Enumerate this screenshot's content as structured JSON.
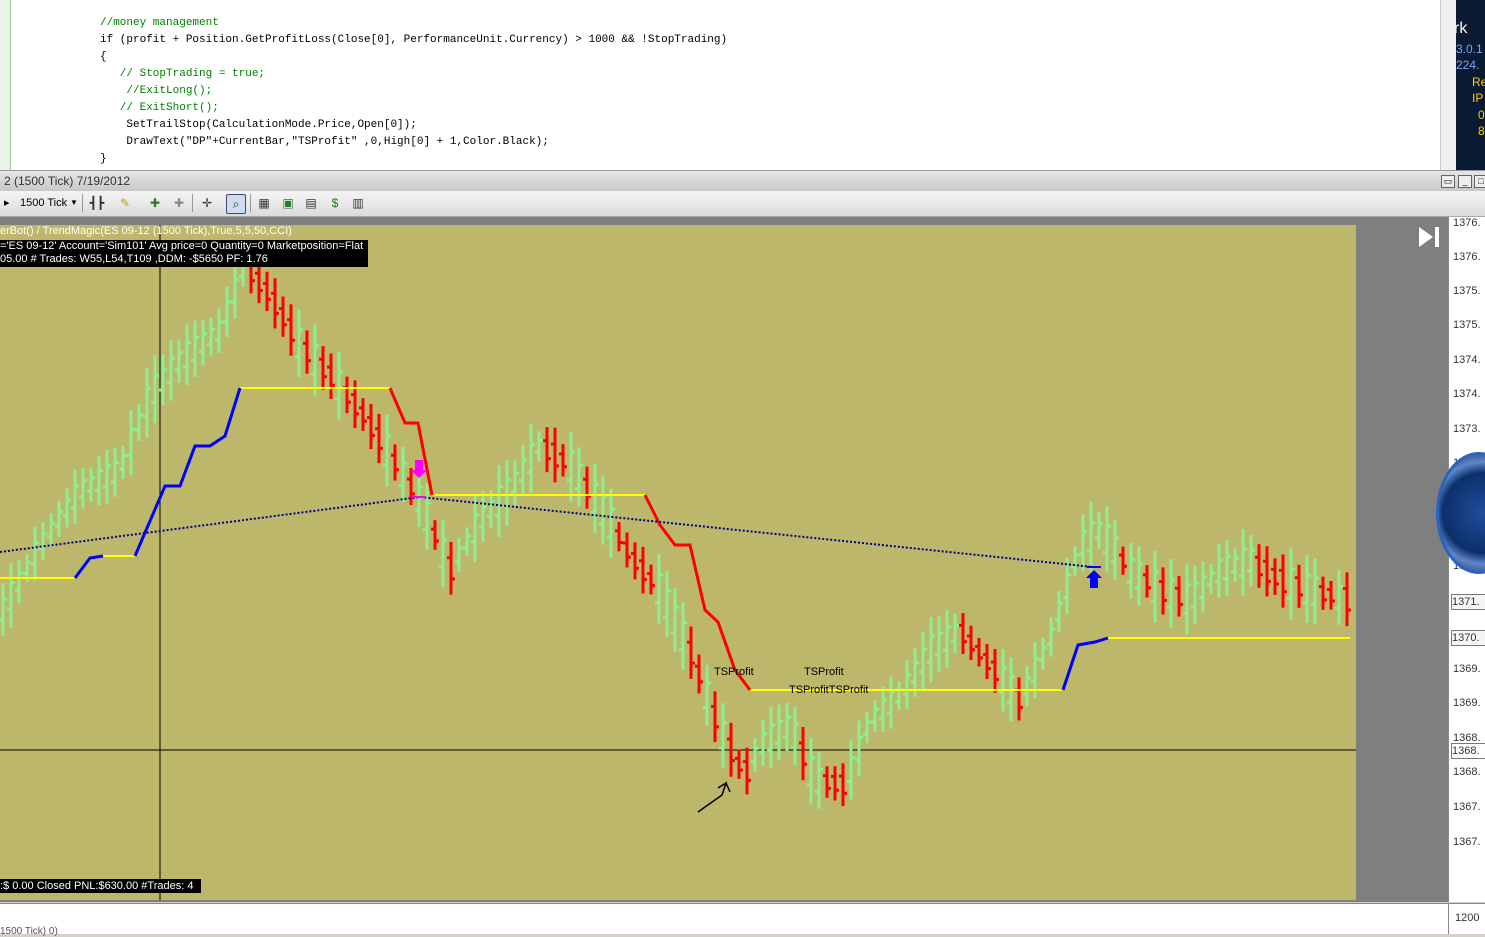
{
  "code_editor": {
    "lines": [
      {
        "cls": "cm",
        "text": "//money management"
      },
      {
        "cls": "",
        "text": "if (profit + Position.GetProfitLoss(Close[0], PerformanceUnit.Currency) > 1000 && !StopTrading)"
      },
      {
        "cls": "",
        "text": "{"
      },
      {
        "cls": "cm",
        "text": "   // StopTrading = true;"
      },
      {
        "cls": "cm",
        "text": "    //ExitLong();"
      },
      {
        "cls": "cm",
        "text": "   // ExitShort();"
      },
      {
        "cls": "",
        "text": "    SetTrailStop(CalculationMode.Price,Open[0]);"
      },
      {
        "cls": "",
        "text": "    DrawText(\"DP\"+CurrentBar,\"TSProfit\" ,0,High[0] + 1,Color.Black);"
      },
      {
        "cls": "",
        "text": "}"
      }
    ]
  },
  "side_panel": {
    "items": [
      {
        "text": "rk",
        "color": "#ffffff"
      },
      {
        "text": "3.0.1",
        "color": "#6fa8ff"
      },
      {
        "text": "224.",
        "color": "#6fa8ff"
      },
      {
        "text": "Re",
        "color": "#ffcc00"
      },
      {
        "text": "IP",
        "color": "#ffcc00"
      },
      {
        "text": "0",
        "color": "#ffcc00"
      },
      {
        "text": "8",
        "color": "#ffcc00"
      }
    ]
  },
  "window": {
    "title": "2 (1500 Tick)  7/19/2012"
  },
  "toolbar": {
    "interval": "1500 Tick"
  },
  "chart": {
    "indicator_label": "erBot() / TrendMagic(ES 09-12 (1500 Tick),True,5,5,50,CCI)",
    "info_line1": "='ES 09-12' Account='Sim101' Avg price=0 Quantity=0 Marketposition=Flat",
    "info_line2": "05.00 # Trades: W55,L54,T109 ,DDM: -$5650 PF: 1.76",
    "pnl_line": ":$ 0.00  Closed PNL:$630.00  #Trades: 4",
    "text_annotations": [
      "TSProfit",
      "TSProfit",
      "TSProfitTSProfit"
    ],
    "price_ticks": [
      "1376.",
      "1376.",
      "1375.",
      "1375.",
      "1374.",
      "1374.",
      "1373.",
      "1373.",
      "1372.",
      "1371.",
      "1371.",
      "1370.",
      "1370.",
      "1369.",
      "1369.",
      "1368.",
      "1368.",
      "1368.",
      "1367.",
      "1367."
    ],
    "price_flags": [
      "1371.",
      "1370.",
      "1368."
    ],
    "sub_label": "1500 Tick) 0)",
    "sub_tick": "1200",
    "colors": {
      "background": "#bdb76b",
      "up_bar": "#90ee90",
      "down_bar": "#ff0000",
      "trend_up": "#0000ff",
      "trend_down": "#ff0000",
      "level": "#ffff00",
      "trendline": "#00008b"
    }
  }
}
